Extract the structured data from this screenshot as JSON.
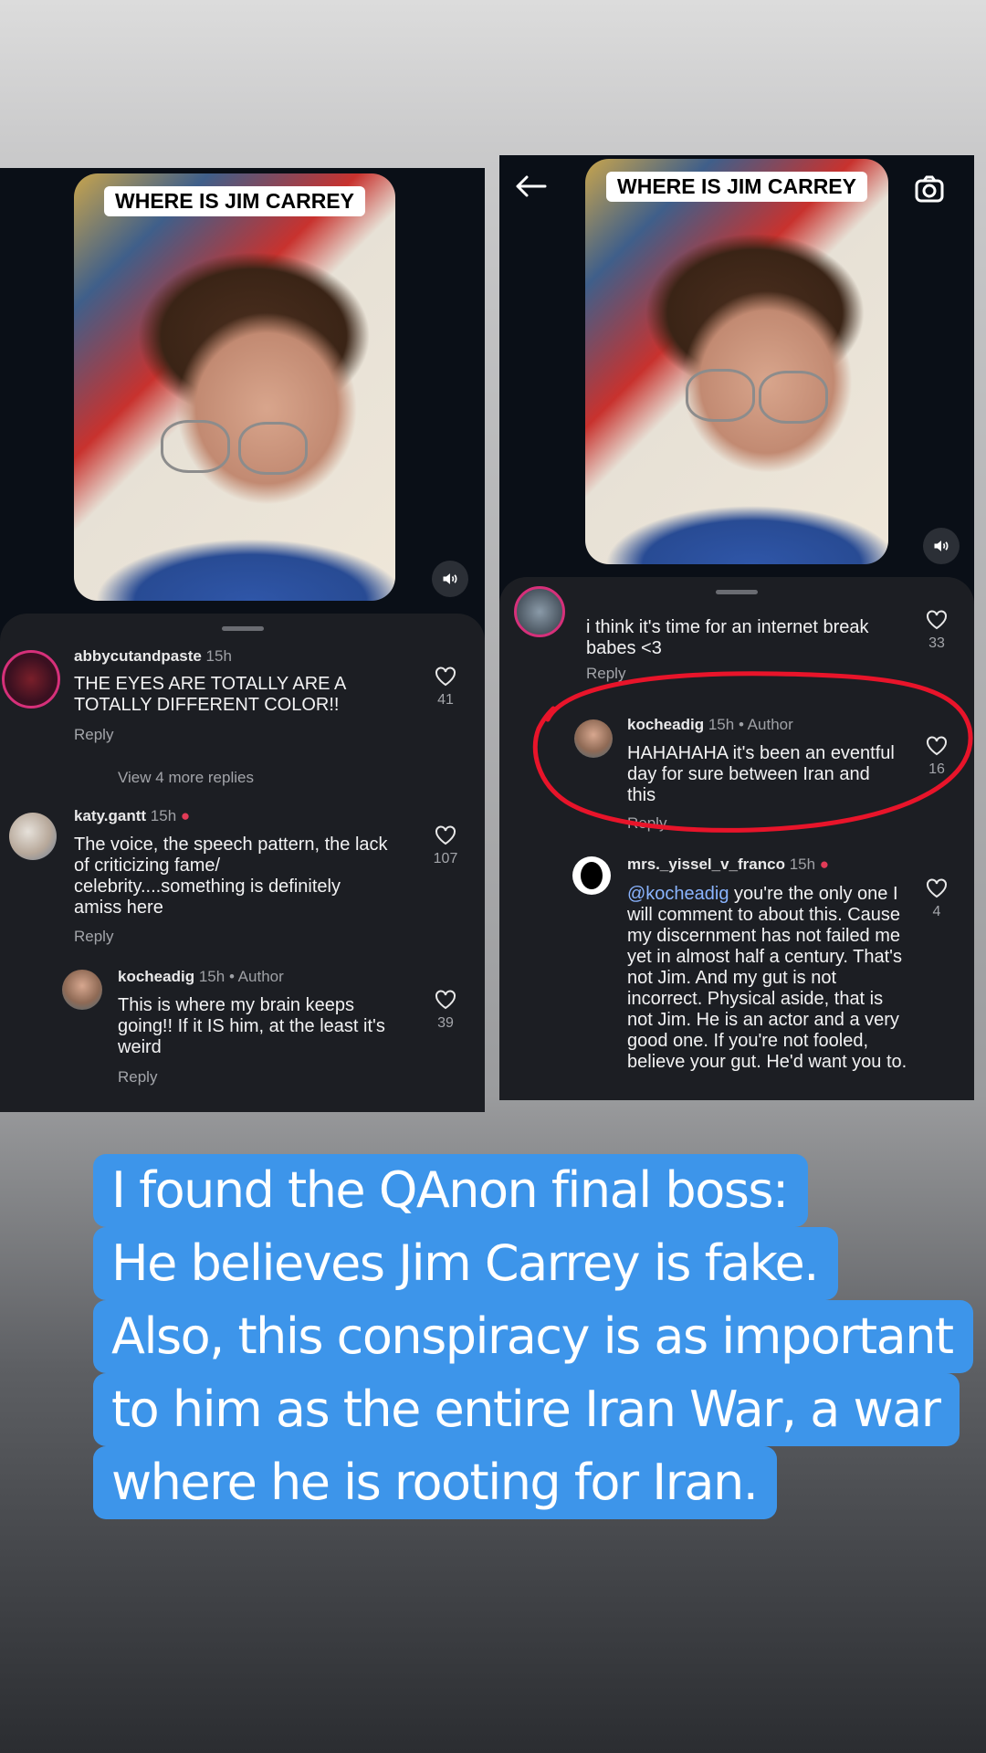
{
  "left": {
    "video_caption": "WHERE IS JIM CARREY",
    "comments": [
      {
        "user": "abbycutandpaste",
        "time": "15h",
        "text": "THE EYES ARE TOTALLY ARE A TOTALLY DIFFERENT COLOR!!",
        "reply": "Reply",
        "likes": "41"
      },
      {
        "view_more": "View 4 more replies"
      },
      {
        "user": "katy.gantt",
        "time": "15h",
        "text": "The voice, the speech pattern, the lack of criticizing fame/ celebrity....something is definitely amiss here",
        "reply": "Reply",
        "likes": "107"
      },
      {
        "user": "kocheadig",
        "time": "15h",
        "badge": "• Author",
        "text": "This is where my brain keeps going!! If it IS him, at the least it's weird",
        "reply": "Reply",
        "likes": "39"
      }
    ]
  },
  "right": {
    "video_caption": "WHERE IS JIM CARREY",
    "comments": [
      {
        "text": "i think it's time for an internet break babes <3",
        "reply": "Reply",
        "likes": "33"
      },
      {
        "user": "kocheadig",
        "time": "15h",
        "badge": "• Author",
        "text": "HAHAHAHA it's been an eventful day for sure between Iran and this",
        "reply": "Reply",
        "likes": "16"
      },
      {
        "user": "mrs._yissel_v_franco",
        "time": "15h",
        "mention": "@kocheadig",
        "text": " you're the only one I will comment to about this. Cause my discernment has not failed me yet in almost half a century. That's not Jim. And my gut is not incorrect. Physical aside, that is not Jim. He is an actor and a very good one. If you're not fooled, believe your gut. He'd want you to.",
        "likes": "4"
      }
    ]
  },
  "caption_lines": [
    "I found the QAnon final boss:",
    "He believes Jim Carrey is fake.",
    "Also, this conspiracy is as important",
    "to him as the entire Iran War, a war",
    "where he is rooting for Iran."
  ],
  "colors": {
    "caption_bg": "#3d95ea",
    "highlight_circle": "#e8142a",
    "sheet_bg": "#1c1e23"
  }
}
